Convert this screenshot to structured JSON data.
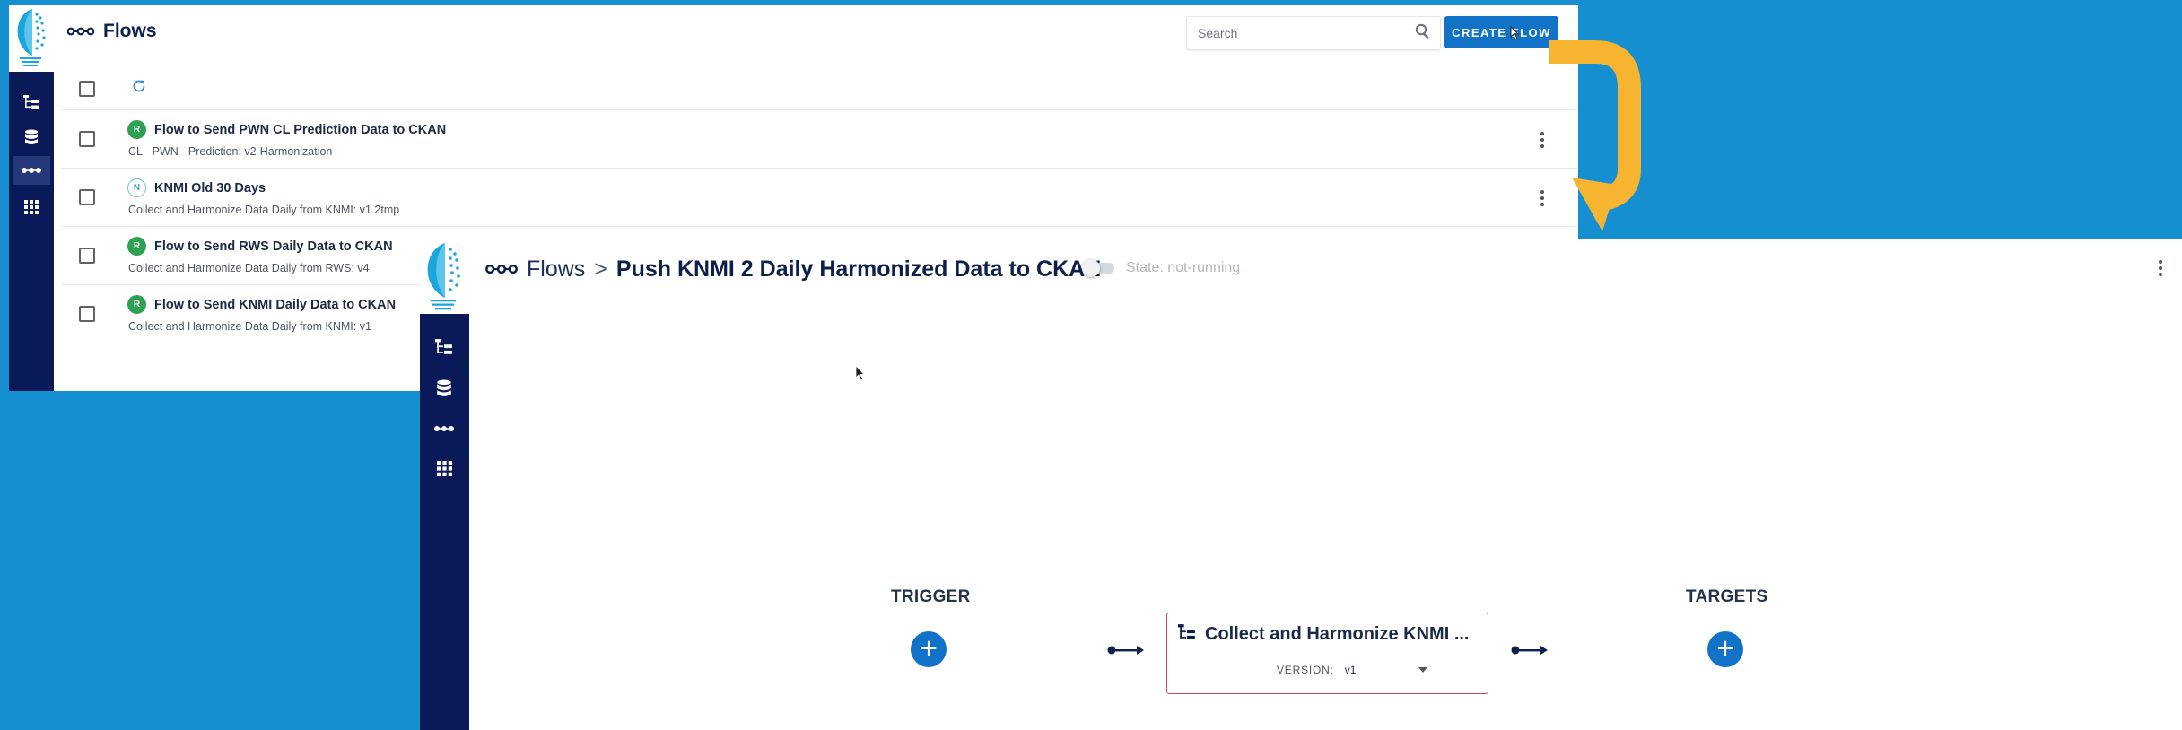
{
  "list_window": {
    "title": "Flows",
    "search": {
      "placeholder": "Search"
    },
    "create_button": "CREATE FLOW",
    "rows": [
      {
        "badge": "R",
        "name": "Flow to Send PWN CL Prediction Data to CKAN",
        "subtitle": "CL - PWN - Prediction:  v2-Harmonization"
      },
      {
        "badge": "N",
        "name": "KNMI Old 30 Days",
        "subtitle": "Collect and Harmonize Data Daily from KNMI:  v1.2tmp"
      },
      {
        "badge": "R",
        "name": "Flow to Send RWS Daily Data to CKAN",
        "subtitle": "Collect and Harmonize Data Daily from RWS:  v4"
      },
      {
        "badge": "R",
        "name": "Flow to Send KNMI Daily Data to CKAN",
        "subtitle": "Collect and Harmonize Data Daily from KNMI:  v1"
      }
    ]
  },
  "detail_window": {
    "breadcrumb_root": "Flows",
    "breadcrumb_separator": ">",
    "flow_name": "Push KNMI 2 Daily Harmonized Data to CKAN",
    "state_text": "State: not-running",
    "trigger_label": "TRIGGER",
    "targets_label": "TARGETS",
    "card": {
      "title": "Collect and Harmonize KNMI ...",
      "version_label": "VERSION:",
      "version_value": "v1"
    }
  },
  "colors": {
    "background": "#168fd1",
    "rail": "#0a1957",
    "primary": "#1173c7",
    "badge_running": "#2fa154",
    "arrow": "#f7b431",
    "card_border": "#d8465a"
  },
  "icons": [
    "flow-icon",
    "search-icon",
    "refresh-icon",
    "tree-icon",
    "database-icon",
    "grid-icon",
    "kebab-icon",
    "plus-icon",
    "connector-arrow-icon",
    "cursor-icon"
  ]
}
